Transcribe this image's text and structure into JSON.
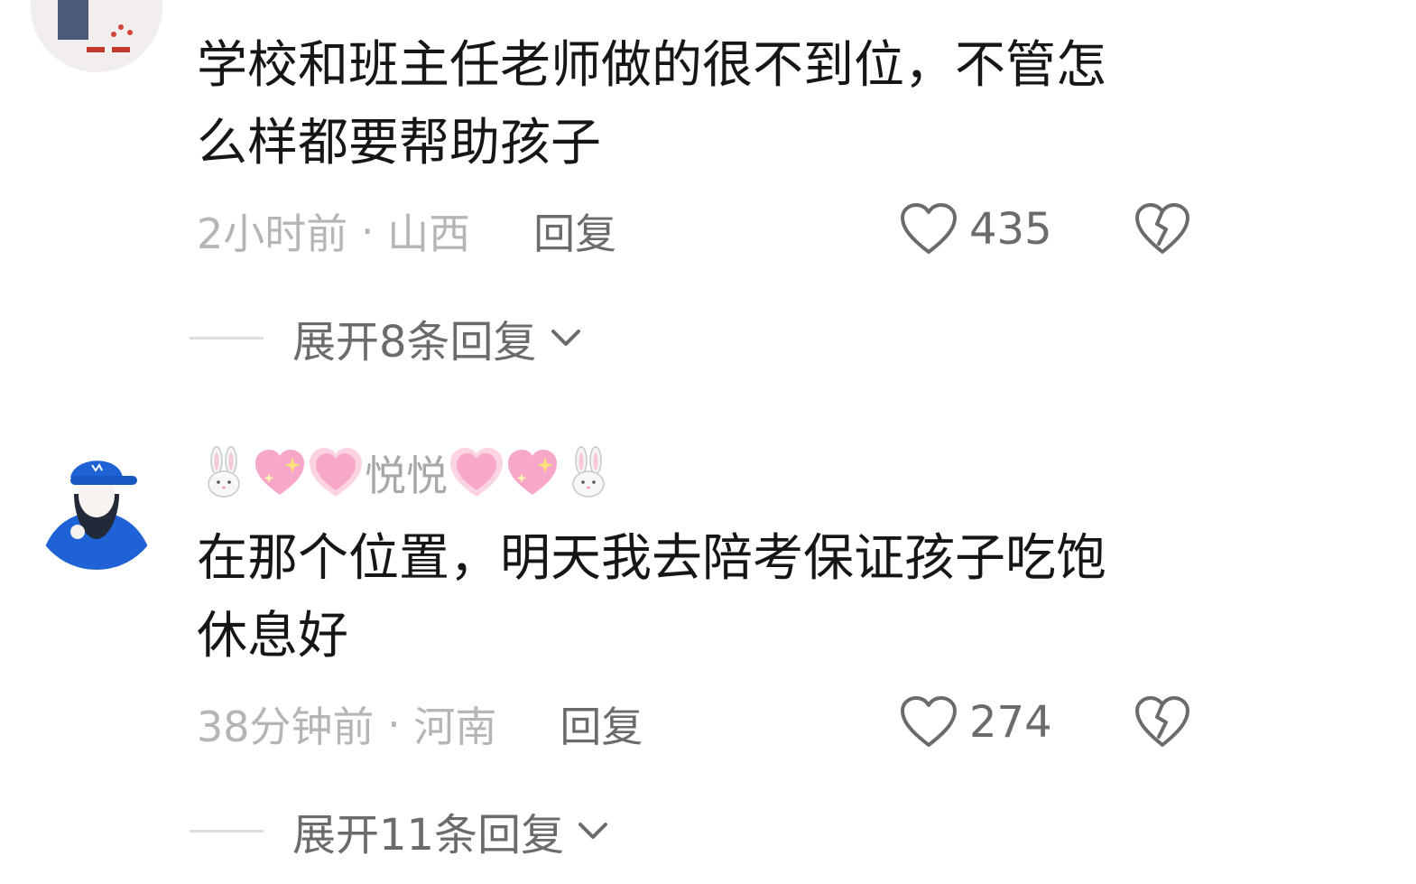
{
  "comments": [
    {
      "nickname": "",
      "text": "学校和班主任老师做的很不到位，不管怎\n么样都要帮助孩子",
      "time": "2小时前",
      "separator": " · ",
      "location": "山西",
      "reply_label": "回复",
      "like_count": "435",
      "expand_label": "展开8条回复"
    },
    {
      "nickname": "悦悦",
      "nickname_emojis": [
        "rabbit-emoji",
        "sparkling-heart-emoji",
        "growing-heart-emoji",
        "growing-heart-emoji",
        "sparkling-heart-emoji",
        "rabbit-emoji"
      ],
      "text": "在那个位置，明天我去陪考保证孩子吃饱\n休息好",
      "time": "38分钟前",
      "separator": " · ",
      "location": "河南",
      "reply_label": "回复",
      "like_count": "274",
      "expand_label": "展开11条回复"
    }
  ],
  "colors": {
    "text_primary": "#161616",
    "text_secondary": "#b5b5b5",
    "text_action": "#6b6b6b",
    "heart_emoji": "#f7a8c8",
    "avatar_cap": "#1e62d6"
  }
}
